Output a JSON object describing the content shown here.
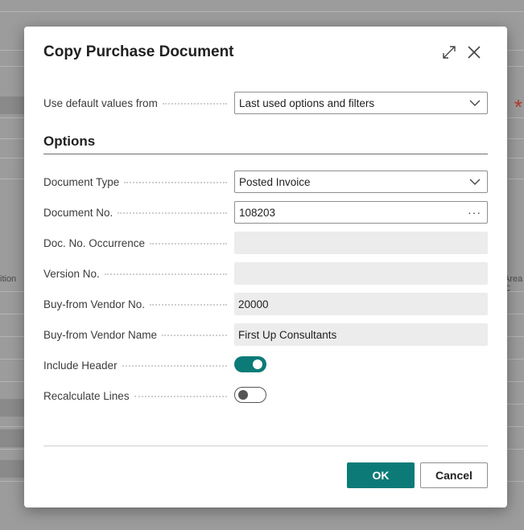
{
  "background": {
    "left_fragment": "ition",
    "right_fragment": "Area C",
    "star": "*"
  },
  "dialog": {
    "title": "Copy Purchase Document",
    "expand_icon": "expand-icon",
    "close_icon": "close-icon"
  },
  "defaults": {
    "label": "Use default values from",
    "value": "Last used options and filters"
  },
  "options": {
    "section_title": "Options",
    "document_type": {
      "label": "Document Type",
      "value": "Posted Invoice"
    },
    "document_no": {
      "label": "Document No.",
      "value": "108203",
      "lookup": "···"
    },
    "doc_no_occurrence": {
      "label": "Doc. No. Occurrence",
      "value": ""
    },
    "version_no": {
      "label": "Version No.",
      "value": ""
    },
    "buy_from_vendor_no": {
      "label": "Buy-from Vendor No.",
      "value": "20000"
    },
    "buy_from_vendor_name": {
      "label": "Buy-from Vendor Name",
      "value": "First Up Consultants"
    },
    "include_header": {
      "label": "Include Header",
      "checked": true
    },
    "recalculate_lines": {
      "label": "Recalculate Lines",
      "checked": false
    }
  },
  "footer": {
    "ok_label": "OK",
    "cancel_label": "Cancel"
  },
  "colors": {
    "accent": "#0c7b78",
    "required_star": "#b23a2a"
  }
}
